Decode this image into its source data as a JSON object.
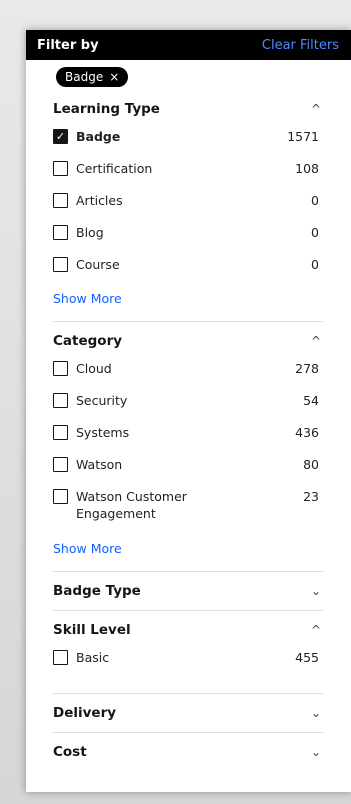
{
  "header": {
    "title": "Filter by",
    "clear_label": "Clear Filters"
  },
  "active_tags": [
    {
      "label": "Badge",
      "remove_glyph": "×"
    }
  ],
  "sections": {
    "learning_type": {
      "title": "Learning Type",
      "expanded": true,
      "chevron": "^",
      "options": [
        {
          "label": "Badge",
          "count": "1571",
          "checked": true
        },
        {
          "label": "Certification",
          "count": "108",
          "checked": false
        },
        {
          "label": "Articles",
          "count": "0",
          "checked": false
        },
        {
          "label": "Blog",
          "count": "0",
          "checked": false
        },
        {
          "label": "Course",
          "count": "0",
          "checked": false
        }
      ],
      "show_more": "Show More"
    },
    "category": {
      "title": "Category",
      "expanded": true,
      "chevron": "^",
      "options": [
        {
          "label": "Cloud",
          "count": "278",
          "checked": false
        },
        {
          "label": "Security",
          "count": "54",
          "checked": false
        },
        {
          "label": "Systems",
          "count": "436",
          "checked": false
        },
        {
          "label": "Watson",
          "count": "80",
          "checked": false
        },
        {
          "label": "Watson Customer Engagement",
          "count": "23",
          "checked": false
        }
      ],
      "show_more": "Show More"
    },
    "badge_type": {
      "title": "Badge Type",
      "expanded": false,
      "chevron": "⌄"
    },
    "skill_level": {
      "title": "Skill Level",
      "expanded": true,
      "chevron": "^",
      "options": [
        {
          "label": "Basic",
          "count": "455",
          "checked": false
        }
      ]
    },
    "delivery": {
      "title": "Delivery",
      "expanded": false,
      "chevron": "⌄"
    },
    "cost": {
      "title": "Cost",
      "expanded": false,
      "chevron": "⌄"
    }
  },
  "check_glyph": "✓",
  "colors": {
    "link": "#0f62fe",
    "clear_link": "#4d8bff",
    "header_bg": "#000000"
  }
}
